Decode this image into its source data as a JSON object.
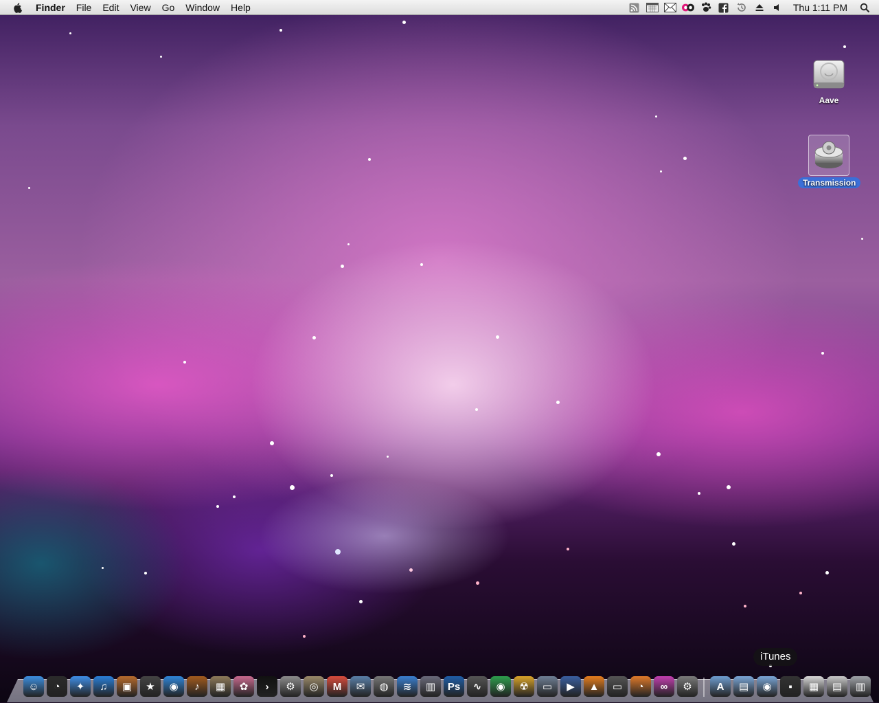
{
  "menubar": {
    "app_name": "Finder",
    "menus": [
      "File",
      "Edit",
      "View",
      "Go",
      "Window",
      "Help"
    ],
    "clock": "Thu 1:11 PM",
    "status_icons": [
      "rss-icon",
      "calendar-icon",
      "mail-icon",
      "music-player-icon",
      "growl-paw-icon",
      "facebook-icon",
      "time-machine-icon",
      "eject-icon",
      "volume-icon"
    ]
  },
  "desktop": {
    "icons": [
      {
        "label": "Aave",
        "icon": "hard-drive-icon",
        "selected": false
      },
      {
        "label": "Transmission",
        "icon": "transmission-icon",
        "selected": true
      }
    ]
  },
  "dock": {
    "tooltip": "iTunes",
    "apps": [
      {
        "name": "finder",
        "color": "#3d8fe0",
        "glyph": "☺"
      },
      {
        "name": "dashboard",
        "color": "#2b2b2b",
        "glyph": "◔"
      },
      {
        "name": "safari",
        "color": "#3f8ee6",
        "glyph": "✦"
      },
      {
        "name": "itunes",
        "color": "#2a7fd8",
        "glyph": "♫"
      },
      {
        "name": "iphoto",
        "color": "#b76b2d",
        "glyph": "▣"
      },
      {
        "name": "imovie",
        "color": "#444444",
        "glyph": "★"
      },
      {
        "name": "idvd",
        "color": "#2f86d9",
        "glyph": "◉"
      },
      {
        "name": "garageband",
        "color": "#a35b1e",
        "glyph": "♪"
      },
      {
        "name": "keynote",
        "color": "#8e7a5a",
        "glyph": "▦"
      },
      {
        "name": "itunes-flower",
        "color": "#c96a8f",
        "glyph": "✿"
      },
      {
        "name": "terminal",
        "color": "#111111",
        "glyph": "›"
      },
      {
        "name": "system-preferences",
        "color": "#8c8c8c",
        "glyph": "⚙"
      },
      {
        "name": "preview",
        "color": "#9b8a6a",
        "glyph": "◎"
      },
      {
        "name": "gmail",
        "color": "#d94c3d",
        "glyph": "M"
      },
      {
        "name": "mail",
        "color": "#5a7fa8",
        "glyph": "✉"
      },
      {
        "name": "photo-booth",
        "color": "#777777",
        "glyph": "◍"
      },
      {
        "name": "wifi",
        "color": "#3a7fd0",
        "glyph": "≋"
      },
      {
        "name": "time-machine-app",
        "color": "#6a6a7a",
        "glyph": "▥"
      },
      {
        "name": "photoshop",
        "color": "#1f5ea8",
        "glyph": "Ps"
      },
      {
        "name": "network-radar",
        "color": "#555555",
        "glyph": "∿"
      },
      {
        "name": "chrome",
        "color": "#2e9e4d",
        "glyph": "◉"
      },
      {
        "name": "radiation-app",
        "color": "#d9a42a",
        "glyph": "☢"
      },
      {
        "name": "ipad-app",
        "color": "#6f7f95",
        "glyph": "▭"
      },
      {
        "name": "mplayer",
        "color": "#3a5fa0",
        "glyph": "▶"
      },
      {
        "name": "vlc",
        "color": "#e67e1e",
        "glyph": "▲"
      },
      {
        "name": "screen-sharing",
        "color": "#555555",
        "glyph": "▭"
      },
      {
        "name": "rss-reader",
        "color": "#e07a2a",
        "glyph": "◔"
      },
      {
        "name": "adium-co",
        "color": "#c33fb0",
        "glyph": "∞"
      },
      {
        "name": "transmission",
        "color": "#7a7a7a",
        "glyph": "⚙"
      }
    ],
    "stacks": [
      {
        "name": "applications-stack",
        "color": "#6f9ed1",
        "glyph": "A"
      },
      {
        "name": "documents-stack",
        "color": "#7aa6d6",
        "glyph": "▤"
      },
      {
        "name": "downloads-stack",
        "color": "#7aa6d6",
        "glyph": "◉"
      },
      {
        "name": "screenshot-stack",
        "color": "#333333",
        "glyph": "▪"
      },
      {
        "name": "calendar-stack",
        "color": "#d8d8d8",
        "glyph": "▦"
      },
      {
        "name": "notes-stack",
        "color": "#c9c9c9",
        "glyph": "▤"
      },
      {
        "name": "trash",
        "color": "#9fa3a8",
        "glyph": "▥"
      }
    ]
  }
}
